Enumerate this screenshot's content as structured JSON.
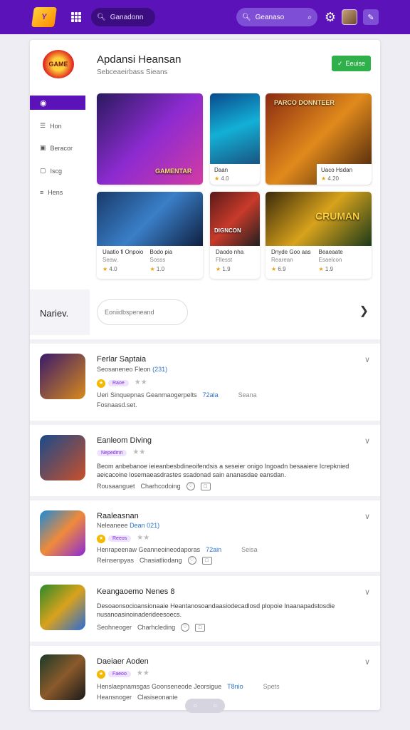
{
  "topbar": {
    "logo_text": "Y",
    "search_left": "Ganadonn",
    "search_right": "Geanaso"
  },
  "header": {
    "title": "Apdansi Heansan",
    "subtitle": "Sebceaeirbass Sieans",
    "follow_label": "Eeuise"
  },
  "sidebar": {
    "items": [
      {
        "label": "Hon"
      },
      {
        "label": "Beracor"
      },
      {
        "label": "Iscg"
      },
      {
        "label": "Hens"
      }
    ]
  },
  "tiles": [
    {
      "title": "",
      "rating": "",
      "art_text": "GAMENTAR"
    },
    {
      "title": "Daan",
      "rating": "4.0"
    },
    {
      "title": "Uaco Hsdan",
      "rating": "4.20",
      "art_text": "PARCO DONNTEER"
    }
  ],
  "wide_tiles": [
    {
      "col1": "Uaatio fi Onpoio",
      "col1_sub": "Seaw.",
      "col1_rating": "4.0",
      "col2": "Bodo pia",
      "col2_sub": "Sosss",
      "col2_rating": "1.0"
    },
    {
      "col1": "Daodo nha",
      "col1_sub": "Fllesst",
      "col1_rating": "1.9",
      "art_text": "DIGNCON"
    },
    {
      "col1": "Dnyde Goo aas",
      "col1_sub": "Rearean",
      "col1_rating": "6.9",
      "col2": "Beaeaate",
      "col2_sub": "Esaelcon",
      "col2_rating": "1.9",
      "art_text": "CRUMAN"
    }
  ],
  "filter": {
    "label": "Nariev.",
    "placeholder": "Eoniidbspeneand"
  },
  "list": [
    {
      "title": "Ferlar Saptaia",
      "sub": "Seosaneneo Fleon",
      "sub_hl": "(231)",
      "tag": "Raoe",
      "meta1": "Ueri Sinquepnas Geanmaogerpelts",
      "meta1_hl": "72ala",
      "meta2": "Seana",
      "meta3": "Fosnaasd.set."
    },
    {
      "title": "Eanleom Diving",
      "tag": "Nepedmn",
      "desc": "Beom anbebanoe ieieanbesbdineoifendsis a seseier onigo Ingoadn besaaiere Icrepknied aeicacoine losemaeasdrastes ssadonad sain ananasdae eansdan.",
      "meta1": "Rousaanguet",
      "meta1b": "Charhcodoing"
    },
    {
      "title": "Raaleasnan",
      "sub": "Neleaneee",
      "sub_hl": "Dean 021)",
      "tag": "Reeos",
      "meta1": "Henrapeenaw Geanneoineodaporas",
      "meta1_hl": "72ain",
      "meta2": "Seisa",
      "meta3": "Reinsenpyas",
      "meta3b": "Chasiatliodang"
    },
    {
      "title": "Keangaoemo Nenes",
      "title_suffix": "8",
      "desc": "Desoaonsocioansionaaie Heantanosoandaasiodecadlosd plopoie Inaanapadstosdie nusanoasinoinaderideesoecs.",
      "meta1": "Seohneoger",
      "meta1b": "Charhcleding"
    },
    {
      "title": "Daeiaer Aoden",
      "tag": "Faeoo",
      "meta1": "Henslaepnamsgas Goonseneode Jeorsigue",
      "meta1_hl": "T8nio",
      "meta2": "Spets",
      "meta3": "Heansnoger",
      "meta3b": "Clasiseonanie"
    }
  ],
  "colors": {
    "brand_purple": "#5b12b8",
    "accent_green": "#2fb04a",
    "link_blue": "#2f73c9"
  }
}
